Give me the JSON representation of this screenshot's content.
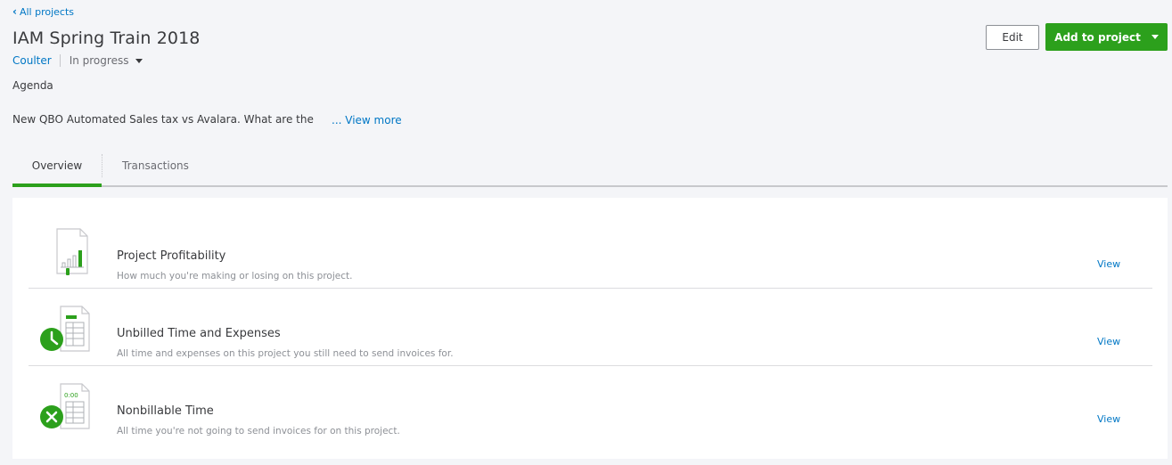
{
  "nav": {
    "back_label": "All projects"
  },
  "project": {
    "title": "IAM Spring Train 2018",
    "customer": "Coulter",
    "status": "In progress",
    "section_label": "Agenda",
    "description": "New QBO Automated Sales tax vs Avalara.  What are the",
    "view_more": "... View more"
  },
  "actions": {
    "edit_label": "Edit",
    "add_label": "Add to project"
  },
  "tabs": [
    {
      "label": "Overview"
    },
    {
      "label": "Transactions"
    }
  ],
  "reports": [
    {
      "title": "Project Profitability",
      "subtitle": "How much you're making or losing on this project.",
      "link": "View",
      "icon": "profitability-report-icon"
    },
    {
      "title": "Unbilled Time and Expenses",
      "subtitle": "All time and expenses on this project you still need to send invoices for.",
      "link": "View",
      "icon": "unbilled-time-icon"
    },
    {
      "title": "Nonbillable Time",
      "subtitle": "All time you're not going to send invoices for on this project.",
      "link": "View",
      "icon": "nonbillable-time-icon",
      "icon_text": "0:00"
    }
  ],
  "colors": {
    "brand_green": "#2ca01c",
    "link_blue": "#0077c5"
  }
}
